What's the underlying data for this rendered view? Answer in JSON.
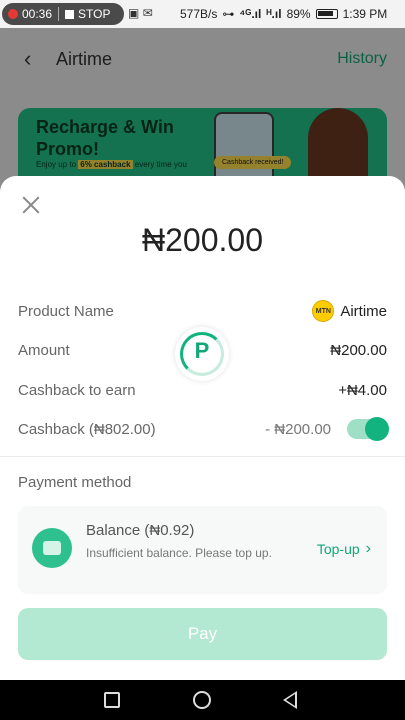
{
  "status_bar": {
    "rec_time": "00:36",
    "stop_label": "STOP",
    "net_speed": "577B/s",
    "battery": "89%",
    "time": "1:39 PM"
  },
  "background": {
    "title": "Airtime",
    "history": "History",
    "promo": {
      "title": "Recharge & Win Promo!",
      "subtitle_prefix": "Enjoy up to",
      "subtitle_highlight": "6% cashback",
      "subtitle_suffix": "every time you",
      "chip": "Cashback received!"
    }
  },
  "sheet": {
    "amount": "₦200.00",
    "rows": [
      {
        "label": "Product Name",
        "value": "Airtime"
      },
      {
        "label": "Amount",
        "value": "₦200.00"
      },
      {
        "label": "Cashback to earn",
        "value": "+₦4.00"
      },
      {
        "label": "Cashback (₦802.00)",
        "value": "- ₦200.00"
      }
    ],
    "mtn_logo_text": "MTN",
    "cashback_toggle_on": true,
    "payment_method_label": "Payment method",
    "balance": {
      "title": "Balance (₦0.92)",
      "subtitle": "Insufficient balance. Please top up.",
      "topup": "Top-up"
    },
    "pay_button": "Pay",
    "spinner_letter": "P"
  },
  "colors": {
    "accent": "#12a777",
    "pay_disabled": "#b3e8d3"
  }
}
